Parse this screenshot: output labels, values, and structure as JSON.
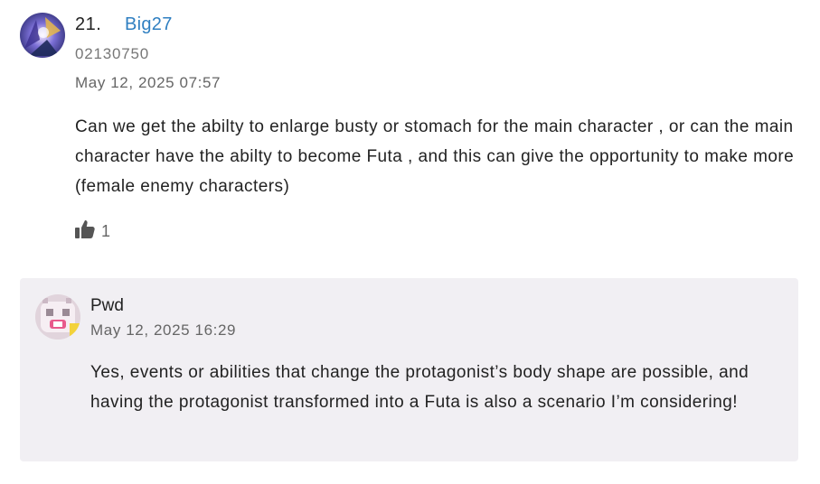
{
  "comment": {
    "floor": "21.",
    "username": "Big27",
    "user_id": "02130750",
    "timestamp": "May 12, 2025 07:57",
    "text": "Can we get the abilty to enlarge busty or stomach for the main character , or can the main character have the abilty to become Futa , and this can give the opportunity to make more (female enemy characters)",
    "like_icon": "thumbs-up-icon",
    "like_count": "1"
  },
  "reply": {
    "username": "Pwd",
    "timestamp": "May 12, 2025 16:29",
    "text": "Yes, events or abilities that change the protagonist’s body shape are possible, and having the protagonist transformed into a Futa is also a scenario I’m considering!"
  },
  "colors": {
    "username_link": "#2f7fc1",
    "reply_background": "#f1eff3",
    "muted_text": "#666666"
  }
}
